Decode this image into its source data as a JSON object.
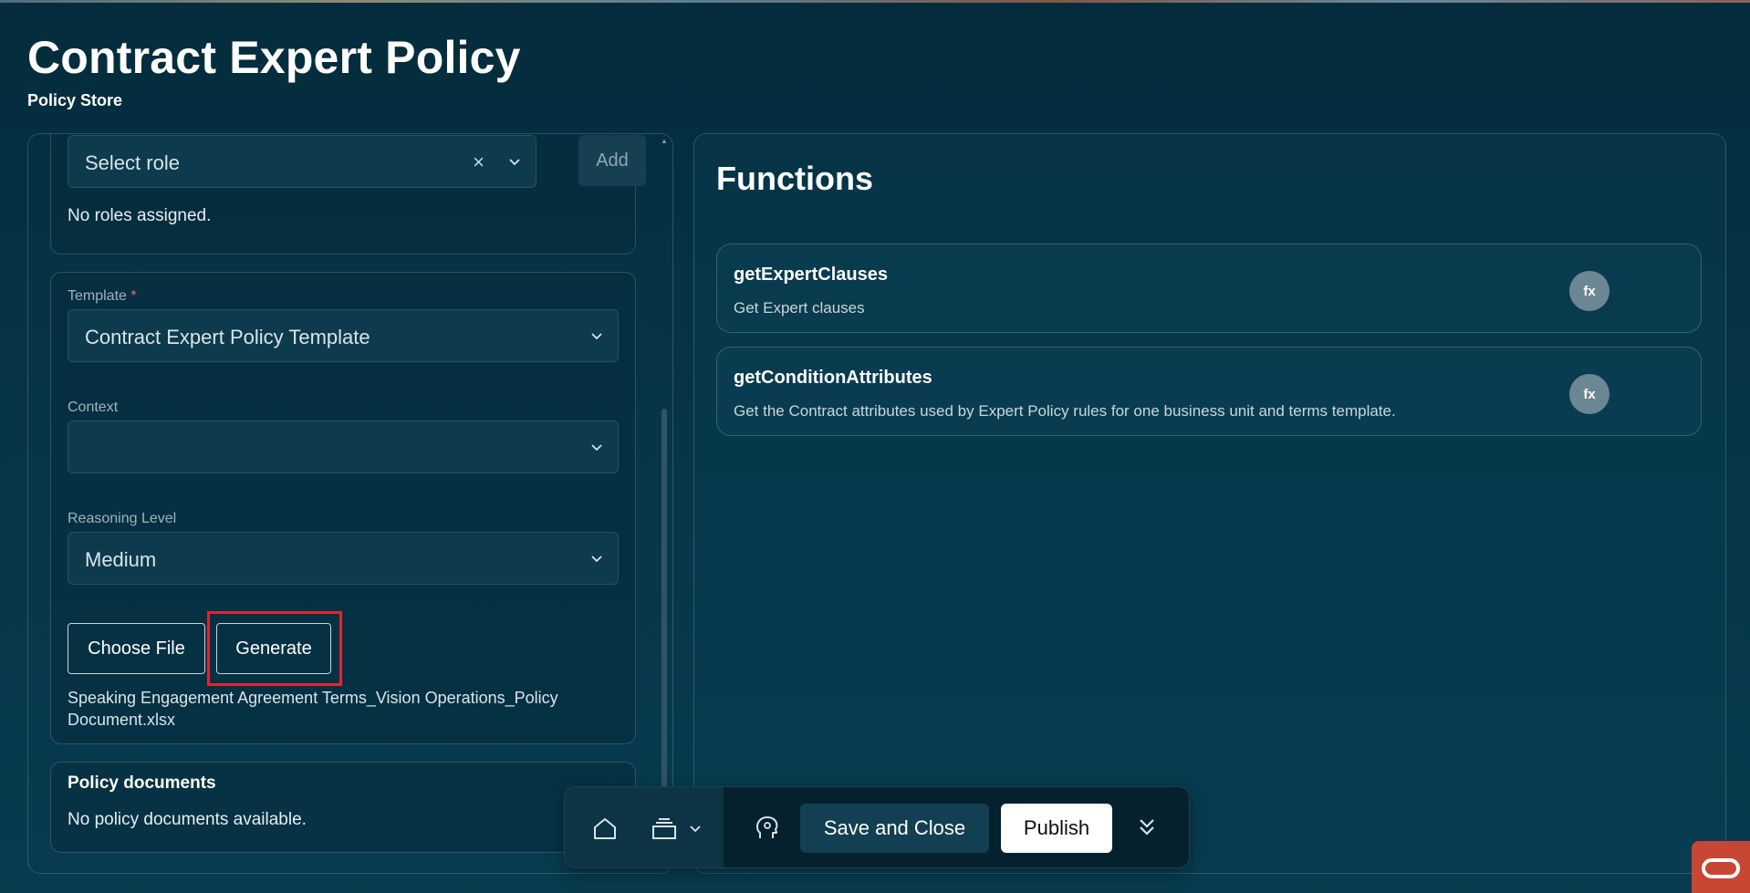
{
  "page": {
    "title": "Contract Expert Policy",
    "subtitle": "Policy Store"
  },
  "roles": {
    "select_placeholder": "Select role",
    "add_label": "Add",
    "empty_text": "No roles assigned."
  },
  "form": {
    "template_label": "Template",
    "template_required_mark": "*",
    "template_value": "Contract Expert Policy Template",
    "context_label": "Context",
    "context_value": "",
    "reasoning_label": "Reasoning Level",
    "reasoning_value": "Medium",
    "choose_file_label": "Choose File",
    "generate_label": "Generate",
    "file_name": "Speaking Engagement Agreement Terms_Vision Operations_Policy Document.xlsx"
  },
  "policy_documents": {
    "title": "Policy documents",
    "empty_text": "No policy documents available."
  },
  "functions": {
    "title": "Functions",
    "items": [
      {
        "name": "getExpertClauses",
        "description": "Get Expert clauses",
        "badge": "fx"
      },
      {
        "name": "getConditionAttributes",
        "description": "Get the Contract attributes used by Expert Policy rules for one business unit and terms template.",
        "badge": "fx"
      }
    ]
  },
  "toolbar": {
    "save_close_label": "Save and Close",
    "publish_label": "Publish",
    "icons": [
      "home-icon",
      "layers-icon",
      "chevron-down-icon",
      "ai-assistant-icon",
      "double-chevron-down-icon"
    ]
  },
  "colors": {
    "background": "#06364a",
    "highlight": "#e0262c",
    "publish_bg": "#ffffff",
    "fx_badge": "#6b8793",
    "oracle_red": "#c74634"
  }
}
